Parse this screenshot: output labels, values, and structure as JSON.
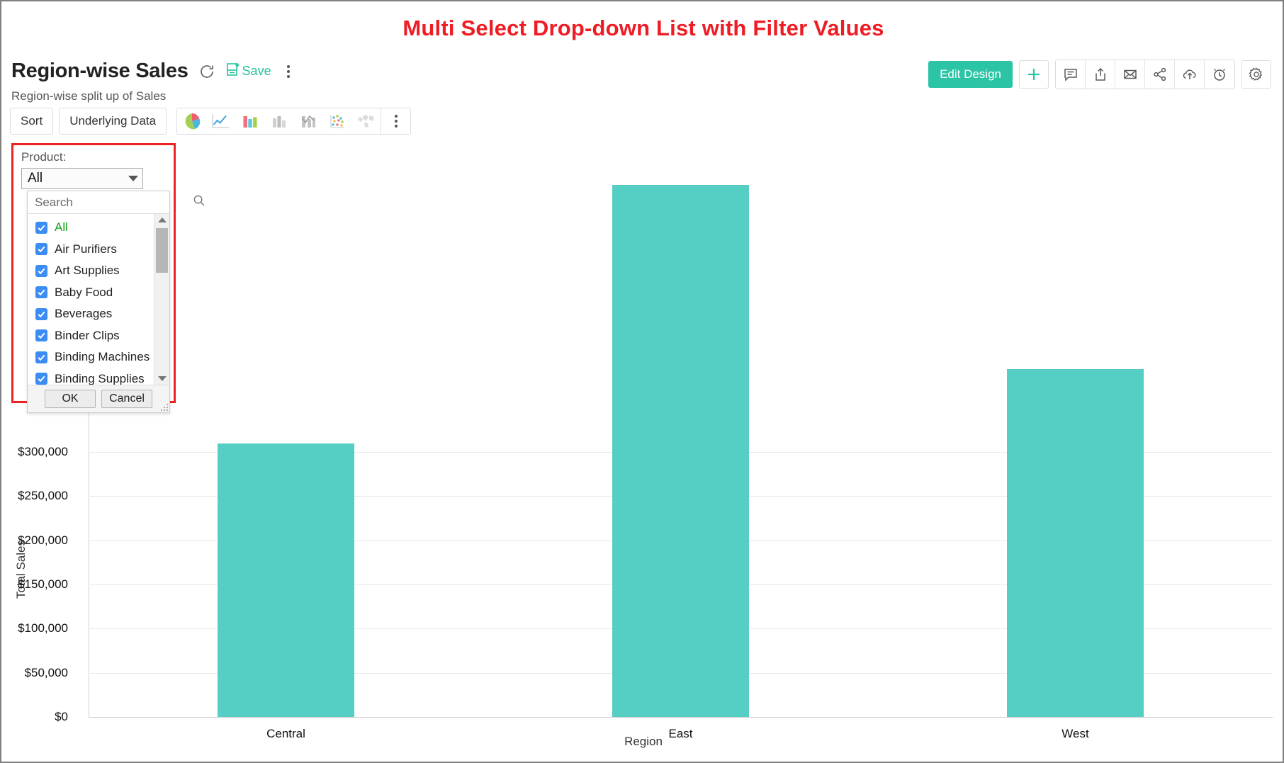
{
  "banner": {
    "title": "Multi Select Drop-down List with Filter Values"
  },
  "report": {
    "title": "Region-wise Sales",
    "subtitle": "Region-wise split up of Sales",
    "refresh_icon": "refresh-icon",
    "save_label": "Save",
    "save_icon": "save-icon",
    "more_icon": "kebab-menu-icon"
  },
  "top_right": {
    "edit_design_label": "Edit Design",
    "buttons": [
      {
        "name": "add-button",
        "icon": "plus-icon"
      },
      {
        "name": "comment-button",
        "icon": "comment-icon"
      },
      {
        "name": "export-button",
        "icon": "export-upload-icon"
      },
      {
        "name": "email-button",
        "icon": "envelope-icon"
      },
      {
        "name": "share-button",
        "icon": "share-nodes-icon"
      },
      {
        "name": "publish-button",
        "icon": "cloud-upload-icon"
      },
      {
        "name": "schedule-button",
        "icon": "alarm-clock-icon"
      }
    ],
    "settings": {
      "name": "settings-button",
      "icon": "gear-icon"
    }
  },
  "chart_toolbar": {
    "sort_label": "Sort",
    "underlying_data_label": "Underlying Data",
    "viz_types": [
      {
        "name": "pie-chart-type",
        "icon": "pie-chart-icon",
        "active": true
      },
      {
        "name": "line-chart-type",
        "icon": "line-chart-icon",
        "active": false
      },
      {
        "name": "bar-chart-type",
        "icon": "bar-chart-icon",
        "active": true
      },
      {
        "name": "stacked-bar-chart-type",
        "icon": "stacked-bar-chart-icon",
        "active": false
      },
      {
        "name": "combo-chart-type",
        "icon": "combo-chart-icon",
        "active": false
      },
      {
        "name": "scatter-chart-type",
        "icon": "scatter-plot-icon",
        "active": false
      },
      {
        "name": "map-chart-type",
        "icon": "map-chart-icon",
        "active": false
      }
    ],
    "more_icon": "kebab-menu-icon"
  },
  "filter": {
    "label": "Product:",
    "selected_value": "All",
    "dropdown_open": true,
    "search_placeholder": "Search",
    "search_value": "",
    "search_icon": "search-icon",
    "ok_label": "OK",
    "cancel_label": "Cancel",
    "options": [
      {
        "label": "All",
        "checked": true,
        "highlight": true
      },
      {
        "label": "Air Purifiers",
        "checked": true,
        "highlight": false
      },
      {
        "label": "Art Supplies",
        "checked": true,
        "highlight": false
      },
      {
        "label": "Baby Food",
        "checked": true,
        "highlight": false
      },
      {
        "label": "Beverages",
        "checked": true,
        "highlight": false
      },
      {
        "label": "Binder Clips",
        "checked": true,
        "highlight": false
      },
      {
        "label": "Binding Machines",
        "checked": true,
        "highlight": false
      },
      {
        "label": "Binding Supplies",
        "checked": true,
        "highlight": false
      }
    ]
  },
  "colors": {
    "bar": "#55cfc3",
    "accent": "#2bc4a5",
    "banner": "#ee1c25",
    "highlight_outline": "#ee2222",
    "checkbox": "#3b8cf5",
    "all_option_text": "#16a016"
  },
  "chart_data": {
    "type": "bar",
    "title": "Region-wise Sales",
    "subtitle": "Region-wise split up of Sales",
    "categories": [
      "Central",
      "East",
      "West"
    ],
    "values": [
      310000,
      603000,
      394000
    ],
    "xlabel": "Region",
    "ylabel": "Total Sales",
    "ylim": [
      0,
      650000
    ],
    "y_ticks": [
      0,
      50000,
      100000,
      150000,
      200000,
      250000,
      300000
    ],
    "y_tick_labels": [
      "$0",
      "$50,000",
      "$100,000",
      "$150,000",
      "$200,000",
      "$250,000",
      "$300,000"
    ],
    "grid": true,
    "legend": false,
    "series_color": "#55cfc3"
  }
}
